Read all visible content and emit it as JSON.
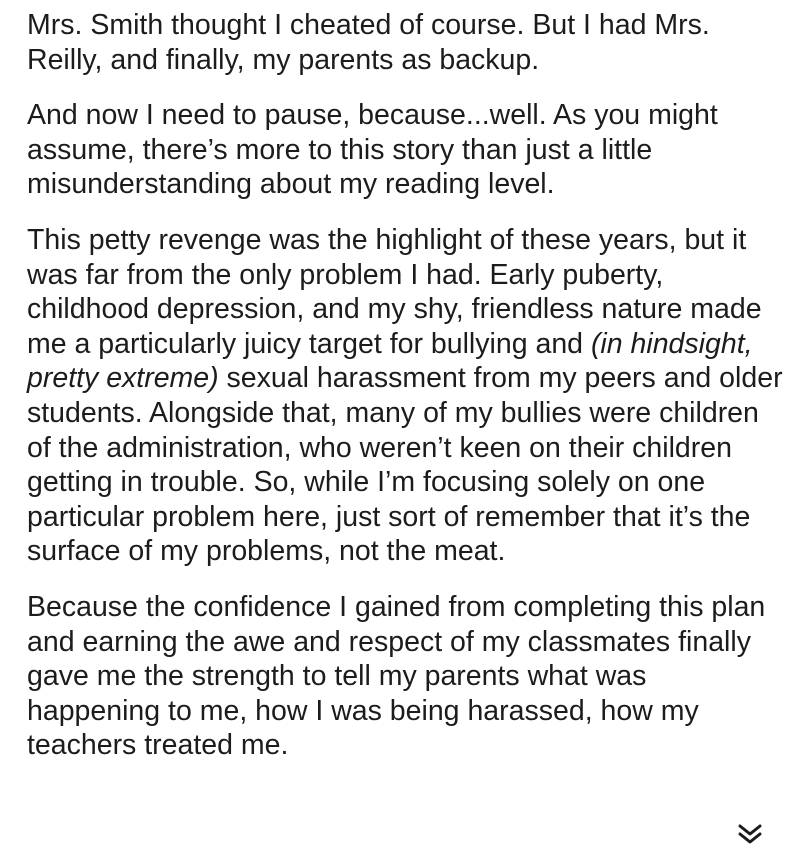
{
  "article": {
    "p1": "Mrs. Smith thought I cheated of course. But I had Mrs. Reilly, and finally, my parents as backup.",
    "p2": "And now I need to pause, because...well. As you might assume, there’s more to this story than just a little misunderstanding about my reading level.",
    "p3a": "This petty revenge was the highlight of these years, but it was far from the only problem I had. Early puberty, childhood depression, and my shy, friendless nature made me a particularly juicy target for bullying and ",
    "p3_italic": "(in hindsight, pretty extreme)",
    "p3b": " sexual harassment from my peers and older students. Alongside that, many of my bullies were children of the administration, who weren’t keen on their children getting in trouble. So, while I’m focusing solely on one particular problem here, just sort of remember that it’s the surface of my problems, not the meat.",
    "p4": "Because the confidence I gained from completing this plan and earning the awe and respect of my classmates finally gave me the strength to tell my parents what was happening to me, how I was being harassed, how my teachers treated me."
  },
  "icons": {
    "scroll_down": "double-chevron-down-icon"
  },
  "colors": {
    "text": "#1c1c1e",
    "background": "#ffffff"
  }
}
